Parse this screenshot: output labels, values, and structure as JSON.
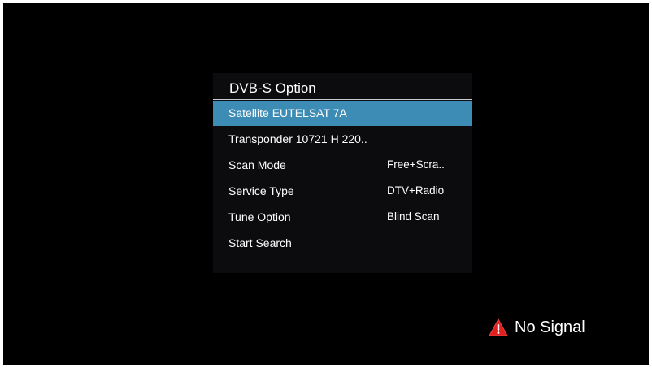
{
  "panel": {
    "title": "DVB-S Option"
  },
  "menu": {
    "items": [
      {
        "label": "Satellite EUTELSAT 7A",
        "value": ""
      },
      {
        "label": "Transponder 10721 H 220..",
        "value": ""
      },
      {
        "label": "Scan Mode",
        "value": "Free+Scra.."
      },
      {
        "label": "Service Type",
        "value": "DTV+Radio"
      },
      {
        "label": "Tune Option",
        "value": "Blind Scan"
      },
      {
        "label": "Start Search",
        "value": ""
      }
    ],
    "selected_index": 0
  },
  "status": {
    "icon": "warning-icon",
    "text": "No Signal",
    "icon_color": "#e02020"
  },
  "colors": {
    "highlight": "#3d8cb5",
    "panel_bg": "#0c0c0f",
    "screen_bg": "#000000"
  }
}
